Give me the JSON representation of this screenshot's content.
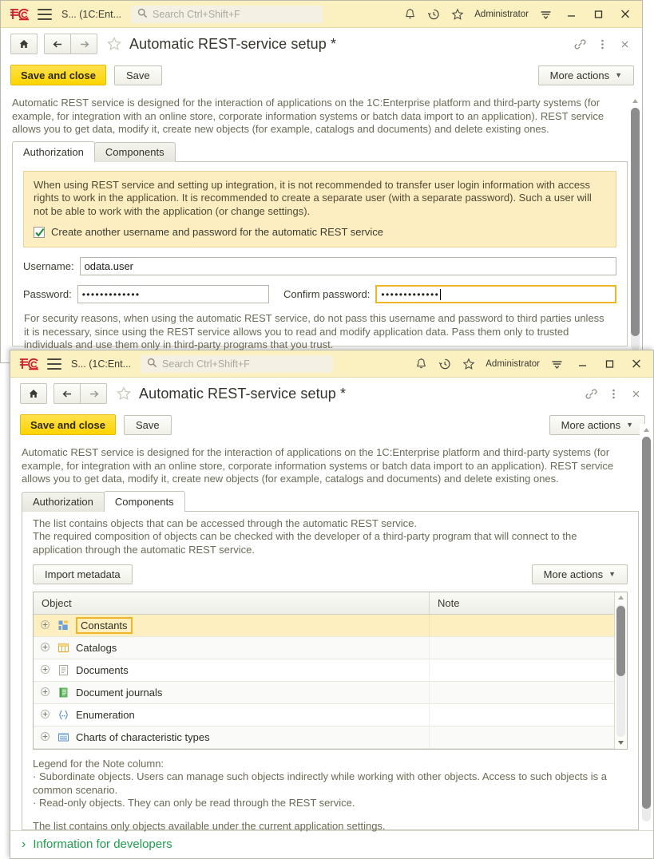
{
  "app": {
    "logo_alt": "1c-logo",
    "title": "S...  (1C:Ent...",
    "user": "Administrator"
  },
  "search": {
    "placeholder": "Search Ctrl+Shift+F"
  },
  "titlebar_icons": {
    "bell": "bell-icon",
    "history": "history-icon",
    "favorites": "star-icon",
    "menu": "main-menu-icon",
    "minimize": "—",
    "maximize": "□",
    "close": "✕"
  },
  "nav": {
    "home": "home-icon",
    "back": "back-arrow-icon",
    "forward": "forward-arrow-icon",
    "favorite": "star-outline-icon",
    "form_title": "Automatic REST-service setup *",
    "link": "link-icon",
    "more": "kebab-menu-icon",
    "close": "✕"
  },
  "commandbar": {
    "save_and_close": "Save and close",
    "save": "Save",
    "more_actions": "More actions"
  },
  "intro": "Automatic REST service is designed for the interaction of applications on the 1C:Enterprise platform and third-party systems (for example, for integration with an online store, corporate information systems or batch data import to an application). REST service allows you to get data, modify it, create new objects (for example, catalogs and documents) and delete existing ones.",
  "tabs": [
    {
      "label": "Authorization"
    },
    {
      "label": "Components"
    }
  ],
  "authorization": {
    "warning": "When using REST service and setting up integration, it is not recommended to transfer user login information with access rights to work in the application. It is recommended to create a separate user (with a separate password). Such a user will not be able to work with the application (or change settings).",
    "checkbox_label": "Create another username and password for the automatic REST service",
    "checkbox_checked": true,
    "username_label": "Username:",
    "username_value": "odata.user",
    "password_label": "Password:",
    "password_value": "•••••••••••••",
    "confirm_label": "Confirm password:",
    "confirm_value": "•••••••••••••",
    "security_note": "For security reasons, when using the automatic REST service, do not pass this username and password to third parties unless it is necessary, since using the REST service allows you to read and modify application data. Pass them only to trusted individuals and use them only in third-party programs that you trust."
  },
  "components": {
    "desc_line1": "The list contains objects that can be accessed through the automatic REST service.",
    "desc_line2": " The required composition of objects can be checked with the developer of a third-party program that will connect to the",
    "desc_line3": "application through the automatic REST service.",
    "import_metadata": "Import metadata",
    "more_actions": "More actions",
    "columns": {
      "object": "Object",
      "note": "Note"
    },
    "rows": [
      {
        "label": "Constants",
        "icon": "constants-icon",
        "note": "",
        "selected": true
      },
      {
        "label": "Catalogs",
        "icon": "catalogs-icon",
        "note": "",
        "selected": false
      },
      {
        "label": "Documents",
        "icon": "documents-icon",
        "note": "",
        "selected": false
      },
      {
        "label": "Document journals",
        "icon": "document-journals-icon",
        "note": "",
        "selected": false
      },
      {
        "label": "Enumeration",
        "icon": "enumeration-icon",
        "note": "",
        "selected": false
      },
      {
        "label": "Charts of characteristic types",
        "icon": "charts-of-characteristic-types-icon",
        "note": "",
        "selected": false
      }
    ],
    "legend_title": "Legend for the Note column:",
    "legend_line1": "· Subordinate objects. Users can manage such objects indirectly while working with other objects. Access to such objects is a common scenario.",
    "legend_line2": "· Read-only objects. They can only be read through the REST service.",
    "legend_footer": "The list contains only objects available under the current application settings."
  },
  "footer": {
    "developers_link": "Information for developers",
    "chevron": "›"
  },
  "colors": {
    "titlebar": "#fbf0c0",
    "accent_yellow": "#ffd400",
    "warning_bg": "#fdeec2",
    "focus_border": "#f0b429",
    "link_green": "#1f9d4e",
    "body_text": "#6b6a55"
  }
}
